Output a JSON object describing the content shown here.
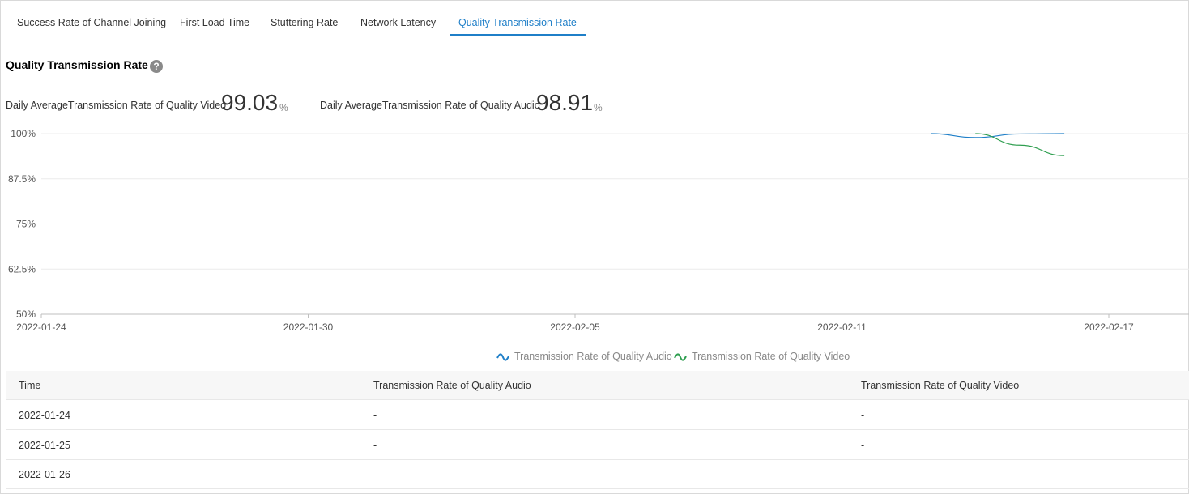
{
  "tabs": [
    {
      "label": "Success Rate of Channel Joining"
    },
    {
      "label": "First Load Time"
    },
    {
      "label": "Stuttering Rate"
    },
    {
      "label": "Network Latency"
    },
    {
      "label": "Quality Transmission Rate"
    }
  ],
  "active_tab": "Quality Transmission Rate",
  "section": {
    "title": "Quality Transmission Rate",
    "help_icon": "?"
  },
  "stats": {
    "video": {
      "label": "Daily AverageTransmission Rate of Quality Video",
      "value": "99.03",
      "unit": "%"
    },
    "audio": {
      "label": "Daily AverageTransmission Rate of Quality Audio",
      "value": "98.91",
      "unit": "%"
    }
  },
  "chart_data": {
    "type": "line",
    "y_ticks": [
      "100%",
      "87.5%",
      "75%",
      "62.5%",
      "50%"
    ],
    "ylim": [
      50,
      100
    ],
    "x_ticks": [
      "2022-01-24",
      "2022-01-30",
      "2022-02-05",
      "2022-02-11",
      "2022-02-17"
    ],
    "xlim": [
      "2022-01-24",
      "2022-02-18"
    ],
    "grid": true,
    "legend_position": "bottom",
    "series": [
      {
        "name": "Transmission Rate of Quality Audio",
        "color": "#1f7fc8",
        "x": [
          "2022-02-13",
          "2022-02-14",
          "2022-02-15",
          "2022-02-16"
        ],
        "y": [
          100,
          98.9,
          99.9,
          100
        ]
      },
      {
        "name": "Transmission Rate of Quality Video",
        "color": "#2e9e4f",
        "x": [
          "2022-02-14",
          "2022-02-15",
          "2022-02-16"
        ],
        "y": [
          100,
          96.8,
          93.9
        ]
      }
    ]
  },
  "table": {
    "headers": [
      "Time",
      "Transmission Rate of Quality Audio",
      "Transmission Rate of Quality Video"
    ],
    "rows": [
      [
        "2022-01-24",
        "-",
        "-"
      ],
      [
        "2022-01-25",
        "-",
        "-"
      ],
      [
        "2022-01-26",
        "-",
        "-"
      ]
    ]
  }
}
